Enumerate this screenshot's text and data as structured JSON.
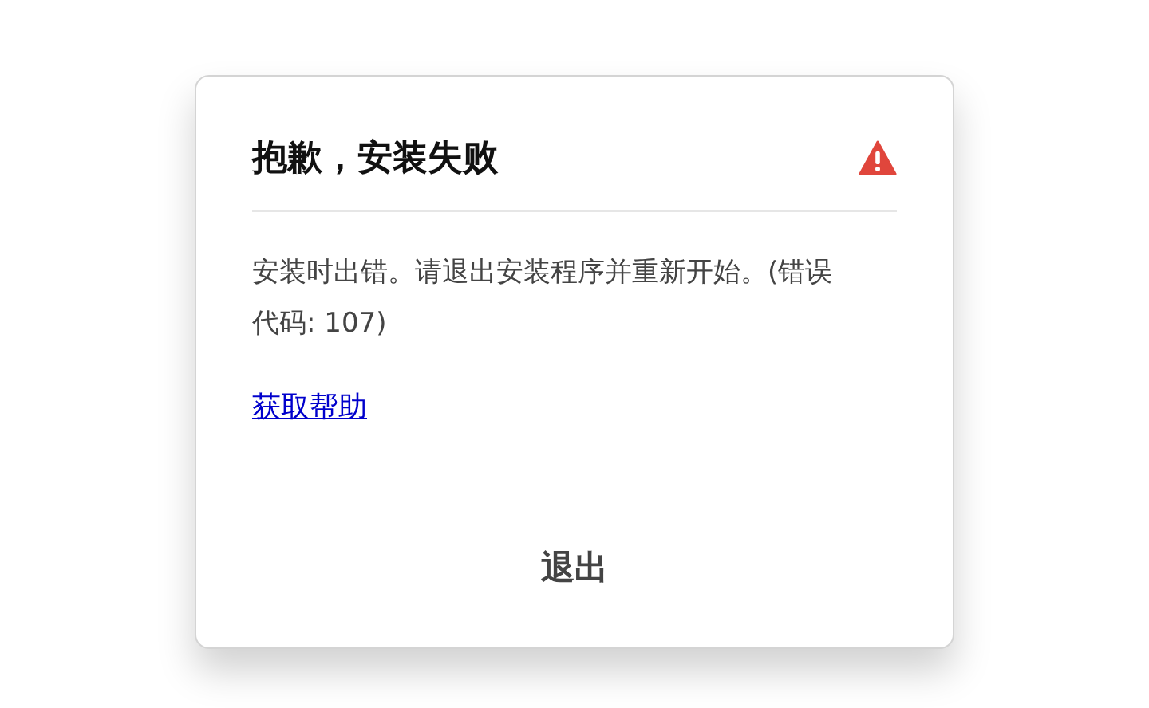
{
  "dialog": {
    "title": "抱歉，安装失败",
    "message": "安装时出错。请退出安装程序并重新开始。(错误代码: 107)",
    "help_link": "获取帮助",
    "buttons": [
      "退出"
    ]
  }
}
